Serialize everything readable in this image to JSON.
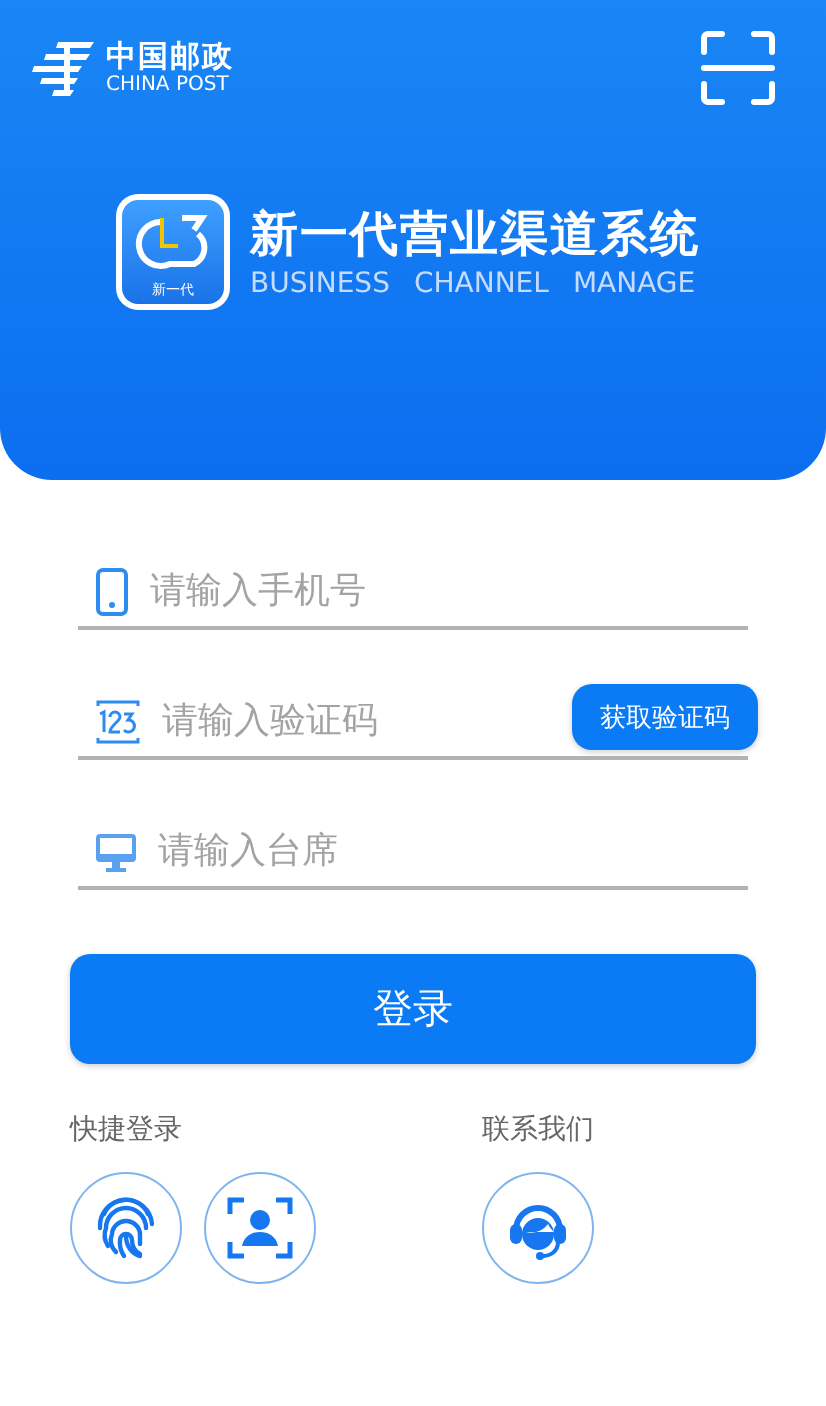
{
  "header": {
    "brand_cn": "中国邮政",
    "brand_en": "CHINA POST",
    "app_badge": "新一代",
    "title": "新一代营业渠道系统",
    "subtitle": [
      "BUSINESS",
      "CHANNEL",
      "MANAGE"
    ]
  },
  "fields": [
    {
      "kind": "phone",
      "placeholder": "请输入手机号"
    },
    {
      "kind": "code",
      "placeholder": "请输入验证码",
      "button": "获取验证码"
    },
    {
      "kind": "desk",
      "placeholder": "请输入台席"
    }
  ],
  "login_button": "登录",
  "quick_login": {
    "label": "快捷登录",
    "methods": [
      {
        "kind": "fingerprint"
      },
      {
        "kind": "face"
      }
    ]
  },
  "contact": {
    "label": "联系我们",
    "methods": [
      {
        "kind": "support"
      }
    ]
  }
}
